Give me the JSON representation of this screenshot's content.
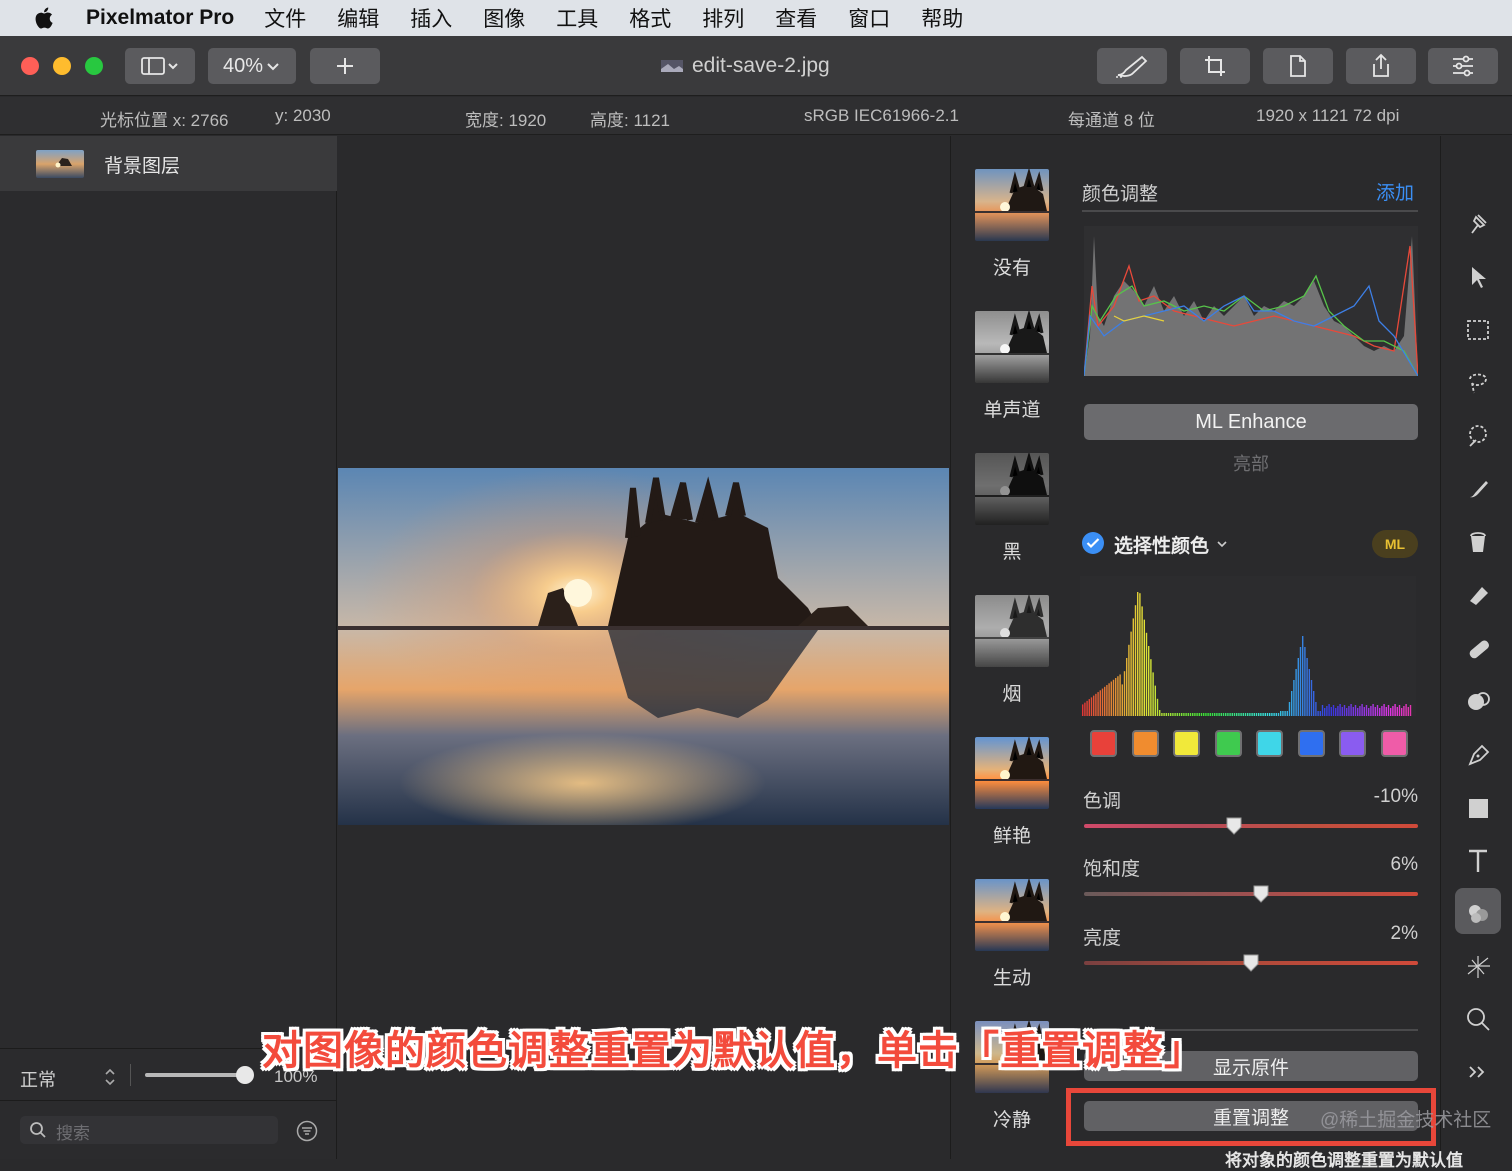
{
  "menubar": {
    "app_name": "Pixelmator Pro",
    "items": [
      "文件",
      "编辑",
      "插入",
      "图像",
      "工具",
      "格式",
      "排列",
      "查看",
      "窗口",
      "帮助"
    ]
  },
  "toolbar": {
    "zoom": "40%",
    "doc_title": "edit-save-2.jpg"
  },
  "infobar": {
    "cursor_x": "光标位置 x:  2766",
    "cursor_y": "y:  2030",
    "width": "宽度:  1920",
    "height": "高度:  1121",
    "profile": "sRGB IEC61966-2.1",
    "depth": "每通道 8 位",
    "size": "1920 x 1121 72 dpi"
  },
  "layers": {
    "layer_name": "背景图层",
    "blend_mode": "正常",
    "opacity": "100%",
    "search_placeholder": "搜索"
  },
  "presets": [
    "没有",
    "单声道",
    "黑",
    "烟",
    "鲜艳",
    "生动",
    "冷静"
  ],
  "adjust": {
    "section_title": "颜色调整",
    "add_label": "添加",
    "ml_enhance": "ML Enhance",
    "highlights": "亮部",
    "selective_color": "选择性颜色",
    "ml_badge": "ML",
    "swatch_colors": [
      "#e8413a",
      "#f08c2f",
      "#f1e93a",
      "#3fca4f",
      "#3fd6e8",
      "#2f6ff0",
      "#8a5cf0",
      "#ef5ca8"
    ],
    "sliders": [
      {
        "label": "色调",
        "value": "-10%"
      },
      {
        "label": "饱和度",
        "value": "6%"
      },
      {
        "label": "亮度",
        "value": "2%"
      }
    ],
    "show_original": "显示原件",
    "reset": "重置调整"
  },
  "overlay": {
    "caption": "对图像的颜色调整重置为默认值，单击「重置调整」",
    "watermark": "@稀土掘金技术社区",
    "bottom_hint": "将对象的颜色调整重置为默认值"
  },
  "colors": {
    "accent_blue": "#3b8ff5",
    "highlight_red": "#e8473a",
    "caption_red": "#f34b3c"
  }
}
